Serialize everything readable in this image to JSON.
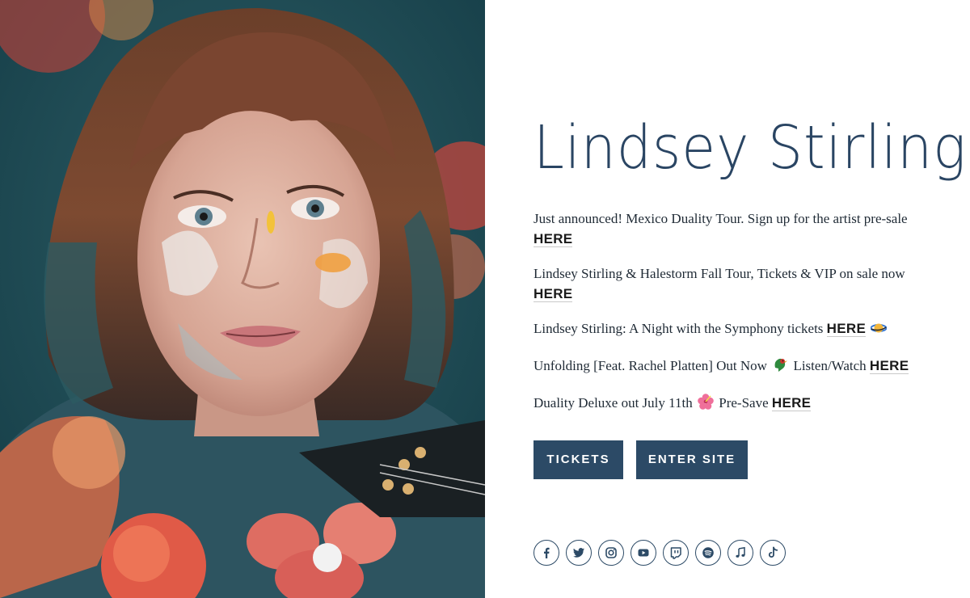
{
  "artist": {
    "name": "Lindsey Stirling"
  },
  "photo": {
    "alt_icon": "artist-portrait-photo"
  },
  "news": [
    {
      "text": "Just announced! Mexico Duality Tour. Sign up for the artist pre-sale ",
      "link": "HERE",
      "suffix_emoji": ""
    },
    {
      "text": "Lindsey Stirling & Halestorm Fall Tour, Tickets & VIP on sale now ",
      "link": "HERE",
      "suffix_emoji": ""
    },
    {
      "text": "Lindsey Stirling: A Night with the Symphony tickets ",
      "link": "HERE",
      "suffix_emoji": "saturn-planet-emoji"
    },
    {
      "text": "Unfolding [Feat. Rachel Platten] Out Now ",
      "mid_emoji": "bird-emoji",
      "text2": " Listen/Watch ",
      "link": "HERE"
    },
    {
      "text": "Duality Deluxe out July 11th ",
      "mid_emoji": "hibiscus-emoji",
      "text2": " Pre-Save ",
      "link": "HERE"
    }
  ],
  "buttons": {
    "tickets": "TICKETS",
    "enter_site": "ENTER SITE"
  },
  "social": [
    "facebook-icon",
    "twitter-icon",
    "instagram-icon",
    "youtube-icon",
    "twitch-icon",
    "spotify-icon",
    "music-note-icon",
    "tiktok-icon"
  ],
  "colors": {
    "accent": "#2c4a66",
    "title": "#2a4563",
    "text": "#1f2a35"
  }
}
